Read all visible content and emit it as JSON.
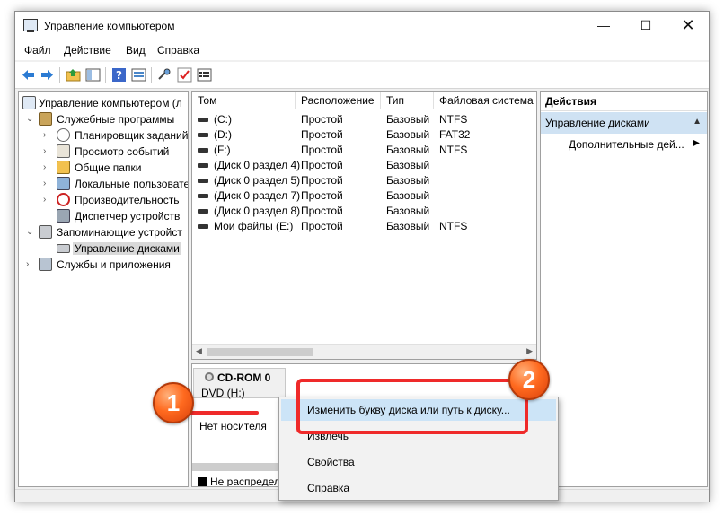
{
  "window": {
    "title": "Управление компьютером"
  },
  "window_buttons": {
    "minimize": "—",
    "maximize": "☐",
    "close": "✕"
  },
  "menu": [
    "Файл",
    "Действие",
    "Вид",
    "Справка"
  ],
  "toolbar_icons": [
    "back-arrow-icon",
    "forward-arrow-icon",
    "up-folder-icon",
    "show-hide-tree-icon",
    "help-icon",
    "properties-icon",
    "connect-icon",
    "check-icon",
    "list-icon"
  ],
  "tree": [
    {
      "label": "Управление компьютером (л",
      "arrow": "",
      "icon": "computer-management-icon"
    },
    {
      "label": "Служебные программы",
      "arrow": "⌄",
      "icon": "tools-icon"
    },
    {
      "label": "Планировщик заданий",
      "arrow": "›",
      "icon": "task-scheduler-icon"
    },
    {
      "label": "Просмотр событий",
      "arrow": "›",
      "icon": "event-viewer-icon"
    },
    {
      "label": "Общие папки",
      "arrow": "›",
      "icon": "shared-folders-icon"
    },
    {
      "label": "Локальные пользовате",
      "arrow": "›",
      "icon": "local-users-icon"
    },
    {
      "label": "Производительность",
      "arrow": "›",
      "icon": "performance-icon"
    },
    {
      "label": "Диспетчер устройств",
      "arrow": "",
      "icon": "device-manager-icon"
    },
    {
      "label": "Запоминающие устройст",
      "arrow": "⌄",
      "icon": "storage-icon"
    },
    {
      "label": "Управление дисками",
      "arrow": "",
      "icon": "disk-management-icon"
    },
    {
      "label": "Службы и приложения",
      "arrow": "›",
      "icon": "services-icon"
    }
  ],
  "columns": [
    "Том",
    "Расположение",
    "Тип",
    "Файловая система"
  ],
  "volumes": [
    {
      "name": "(C:)",
      "layout": "Простой",
      "type": "Базовый",
      "fs": "NTFS"
    },
    {
      "name": "(D:)",
      "layout": "Простой",
      "type": "Базовый",
      "fs": "FAT32"
    },
    {
      "name": "(F:)",
      "layout": "Простой",
      "type": "Базовый",
      "fs": "NTFS"
    },
    {
      "name": "(Диск 0 раздел 4)",
      "layout": "Простой",
      "type": "Базовый",
      "fs": ""
    },
    {
      "name": "(Диск 0 раздел 5)",
      "layout": "Простой",
      "type": "Базовый",
      "fs": ""
    },
    {
      "name": "(Диск 0 раздел 7)",
      "layout": "Простой",
      "type": "Базовый",
      "fs": ""
    },
    {
      "name": "(Диск 0 раздел 8)",
      "layout": "Простой",
      "type": "Базовый",
      "fs": ""
    },
    {
      "name": "Мои файлы (E:)",
      "layout": "Простой",
      "type": "Базовый",
      "fs": "NTFS"
    }
  ],
  "disk": {
    "title": "CD-ROM 0",
    "subtitle": "DVD (H:)",
    "status": "Нет носителя",
    "legend": "Не распредел"
  },
  "actions": {
    "header": "Действия",
    "section": "Управление дисками",
    "more": "Дополнительные дей..."
  },
  "context_menu": [
    "Изменить букву диска или путь к диску...",
    "Извлечь",
    "Свойства",
    "Справка"
  ],
  "annotations": {
    "badge1": "1",
    "badge2": "2"
  },
  "colors": {
    "highlight": "#cce4f7",
    "annotation_red": "#ef2a2a",
    "badge_orange": "#ff6a1f",
    "actions_section": "#cfe2f3"
  }
}
